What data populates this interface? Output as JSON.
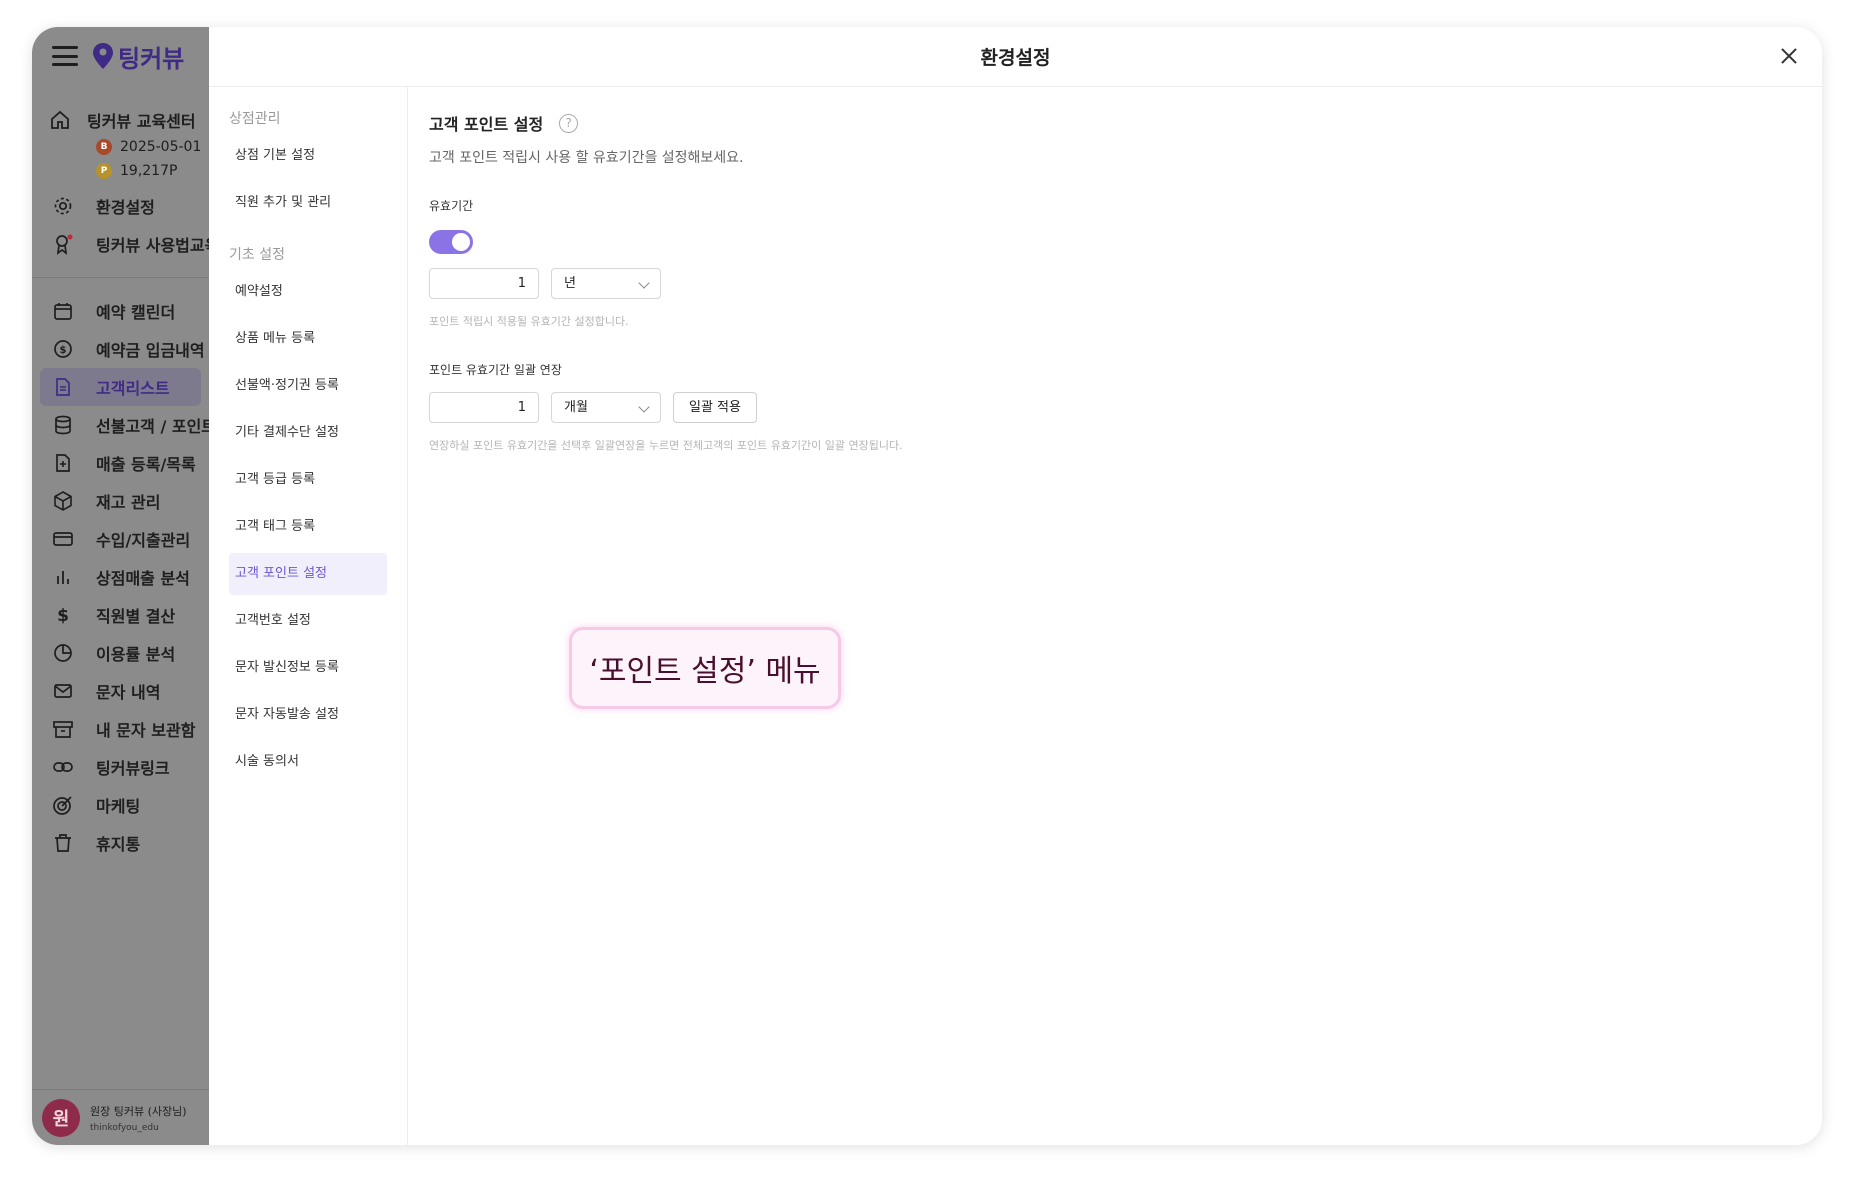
{
  "sidebar": {
    "logo_text": "팅커뷰",
    "store_name": "팅커뷰 교육센터",
    "expire_date": "2025-05-01",
    "points": "19,217P",
    "settings_label": "환경설정",
    "edu_label": "팅커뷰 사용법교육",
    "menu": [
      {
        "label": "예약 캘린더",
        "icon": "calendar-icon"
      },
      {
        "label": "예약금 입금내역",
        "icon": "deposit-icon"
      },
      {
        "label": "고객리스트",
        "icon": "document-icon"
      },
      {
        "label": "선불고객 / 포인트고객",
        "icon": "database-icon"
      },
      {
        "label": "매출 등록/목록",
        "icon": "file-plus-icon"
      },
      {
        "label": "재고 관리",
        "icon": "box-icon"
      },
      {
        "label": "수입/지출관리",
        "icon": "card-icon"
      },
      {
        "label": "상점매출 분석",
        "icon": "bar-chart-icon"
      },
      {
        "label": "직원별 결산",
        "icon": "dollar-icon"
      },
      {
        "label": "이용률 분석",
        "icon": "pie-chart-icon"
      },
      {
        "label": "문자 내역",
        "icon": "mail-icon"
      },
      {
        "label": "내 문자 보관함",
        "icon": "archive-icon"
      },
      {
        "label": "팅커뷰링크",
        "icon": "link-icon"
      },
      {
        "label": "마케팅",
        "icon": "target-icon"
      },
      {
        "label": "휴지통",
        "icon": "trash-icon"
      }
    ],
    "user": {
      "initial": "원",
      "name": "원장 팅커뷰 (사장님)",
      "id": "thinkofyou_edu"
    }
  },
  "modal": {
    "title": "환경설정",
    "nav": {
      "group1": "상점관리",
      "group1_items": [
        "상점 기본 설정",
        "직원 추가 및 관리"
      ],
      "group2": "기초 설정",
      "group2_items": [
        "예약설정",
        "상품 메뉴 등록",
        "선불액·정기권 등록",
        "기타 결제수단 설정",
        "고객 등급 등록",
        "고객 태그 등록",
        "고객 포인트 설정",
        "고객번호 설정",
        "문자 발신정보 등록",
        "문자 자동발송 설정",
        "시술 동의서"
      ]
    },
    "content": {
      "title": "고객 포인트 설정",
      "description": "고객 포인트 적립시 사용 할 유효기간을 설정해보세요.",
      "validity_label": "유효기간",
      "validity_enabled": true,
      "validity_value": "1",
      "validity_unit": "년",
      "validity_hint": "포인트 적립시 적용될 유효기간 설정합니다.",
      "extend_label": "포인트 유효기간 일괄 연장",
      "extend_value": "1",
      "extend_unit": "개월",
      "apply_button": "일괄 적용",
      "extend_hint": "연장하실 포인트 유효기간을 선택후 일괄연장을 누르면 전체고객의 포인트 유효기간이 일괄 연장됩니다."
    }
  },
  "callout": "‘포인트 설정’ 메뉴"
}
